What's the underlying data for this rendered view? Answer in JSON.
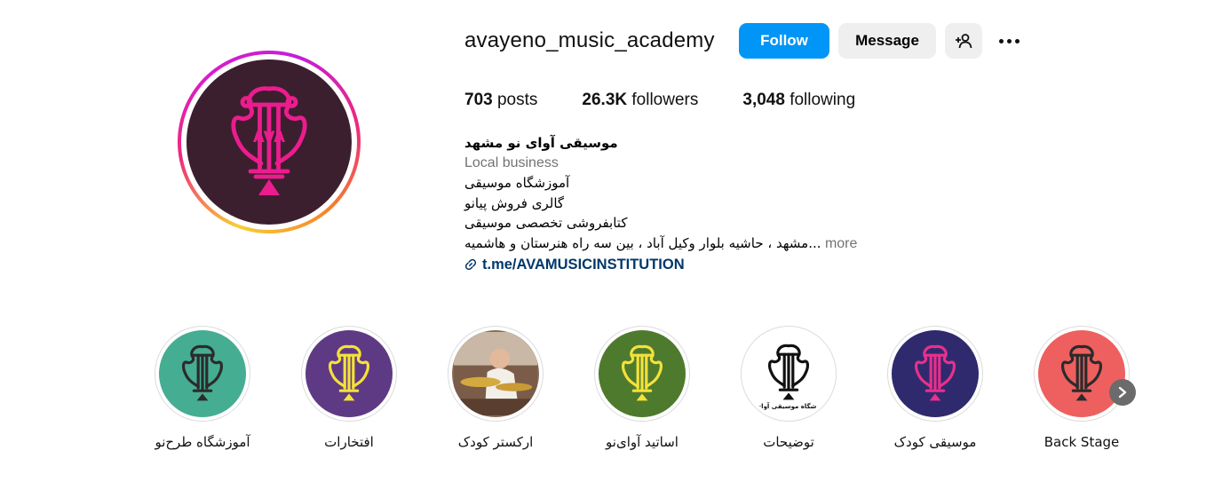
{
  "profile": {
    "username": "avayeno_music_academy",
    "follow_label": "Follow",
    "message_label": "Message",
    "suggest_icon": "add-person-icon",
    "more_icon": "more-options-icon",
    "avatar_logo_text": "AVA",
    "colors": {
      "follow": "#0095f6",
      "link": "#00376b",
      "avatar_bg": "#3c1f2e",
      "logo": "#ec1c8f"
    }
  },
  "stats": [
    {
      "value": "703",
      "label": "posts"
    },
    {
      "value": "26.3K",
      "label": "followers"
    },
    {
      "value": "3,048",
      "label": "following"
    }
  ],
  "bio": {
    "name": "موسیقی آوای نو مشهد",
    "category": "Local business",
    "lines": [
      "آموزشگاه موسیقی",
      "گالری فروش پیانو",
      "کتابفروشی تخصصی موسیقی"
    ],
    "address": "مشهد ، حاشیه بلوار وکیل آباد ، بین سه راه هنرستان و هاشمیه...",
    "more_label": "more",
    "link_icon": "link-icon",
    "link": "t.me/AVAMUSICINSTITUTION"
  },
  "highlights": [
    {
      "label": "آموزشگاه طرح‌نو",
      "bg": "#45ad92",
      "logo": "#2b2b2b"
    },
    {
      "label": "افتخارات",
      "bg": "#5e3a84",
      "logo": "#f4e13b"
    },
    {
      "label": "ارکستر کودک",
      "bg": "#8a6b55",
      "logo": ""
    },
    {
      "label": "اساتید آوای‌نو",
      "bg": "#4e7a2d",
      "logo": "#f4e13b"
    },
    {
      "label": "توضیحات",
      "bg": "#ffffff",
      "logo": "#111111",
      "caption": "آموزشگاه موسیقی آوای نو"
    },
    {
      "label": "موسیقی کودک",
      "bg": "#2f2a6e",
      "logo": "#e8308c"
    },
    {
      "label": "Back Stage",
      "bg": "#ee5f5f",
      "logo": "#2b2b2b"
    }
  ],
  "next_icon": "chevron-right-icon"
}
